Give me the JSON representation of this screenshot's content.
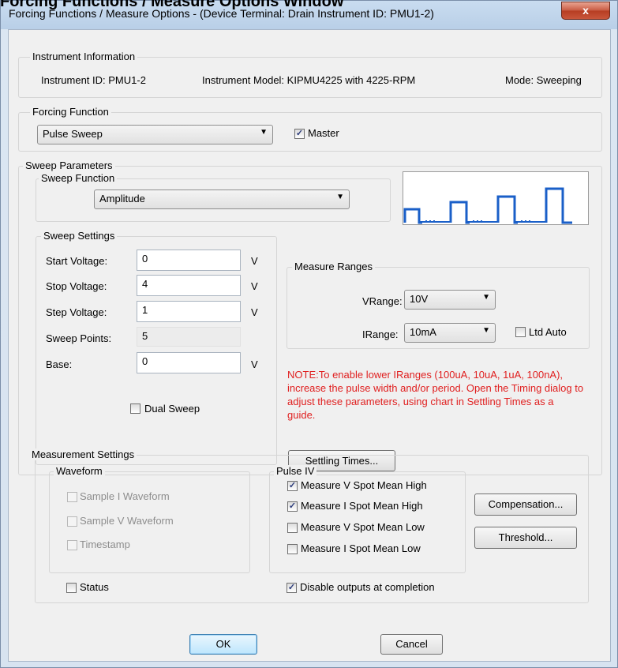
{
  "page_header": "Forcing Functions / Measure Options Window",
  "window": {
    "title": "Forcing Functions / Measure Options - (Device Terminal: Drain  Instrument ID: PMU1-2)",
    "close_glyph": "x"
  },
  "instrument_info": {
    "group_label": "Instrument Information",
    "instrument_id": "Instrument ID:  PMU1-2",
    "instrument_model": "Instrument Model:  KIPMU4225 with 4225-RPM",
    "mode": "Mode:  Sweeping"
  },
  "forcing_function": {
    "group_label": "Forcing Function",
    "selected": "Pulse Sweep",
    "master_label": "Master",
    "master_checked": true
  },
  "sweep_parameters": {
    "group_label": "Sweep Parameters",
    "sweep_function": {
      "group_label": "Sweep Function",
      "selected": "Amplitude"
    },
    "sweep_settings": {
      "group_label": "Sweep Settings",
      "start_label": "Start Voltage:",
      "start_value": "0",
      "start_unit": "V",
      "stop_label": "Stop Voltage:",
      "stop_value": "4",
      "stop_unit": "V",
      "step_label": "Step Voltage:",
      "step_value": "1",
      "step_unit": "V",
      "points_label": "Sweep Points:",
      "points_value": "5",
      "base_label": "Base:",
      "base_value": "0",
      "base_unit": "V",
      "dual_sweep_label": "Dual Sweep",
      "dual_sweep_checked": false
    },
    "measure_ranges": {
      "group_label": "Measure Ranges",
      "vrange_label": "VRange:",
      "vrange_value": "10V",
      "irange_label": "IRange:",
      "irange_value": "10mA",
      "ltd_auto_label": "Ltd Auto",
      "ltd_auto_checked": false
    },
    "note": "NOTE:To enable lower IRanges (100uA, 10uA, 1uA, 100nA), increase the pulse width and/or period. Open the Timing dialog to adjust these parameters, using chart in Settling Times as a guide.",
    "settling_times_button": "Settling Times..."
  },
  "measurement_settings": {
    "group_label": "Measurement Settings",
    "waveform": {
      "group_label": "Waveform",
      "sample_i": "Sample I Waveform",
      "sample_v": "Sample V Waveform",
      "timestamp": "Timestamp"
    },
    "pulse_iv": {
      "group_label": "Pulse IV",
      "v_high": "Measure V Spot Mean High",
      "v_high_checked": true,
      "i_high": "Measure I Spot Mean High",
      "i_high_checked": true,
      "v_low": "Measure V Spot Mean Low",
      "v_low_checked": false,
      "i_low": "Measure I Spot Mean Low",
      "i_low_checked": false
    },
    "compensation_button": "Compensation...",
    "threshold_button": "Threshold...",
    "status_label": "Status",
    "status_checked": false,
    "disable_outputs_label": "Disable outputs at completion",
    "disable_outputs_checked": true
  },
  "footer": {
    "ok": "OK",
    "cancel": "Cancel"
  },
  "icons": {
    "check": "✓",
    "dropdown_arrow": "▼"
  },
  "colors": {
    "note_red": "#e02020",
    "preview_blue": "#1a5fc8"
  }
}
